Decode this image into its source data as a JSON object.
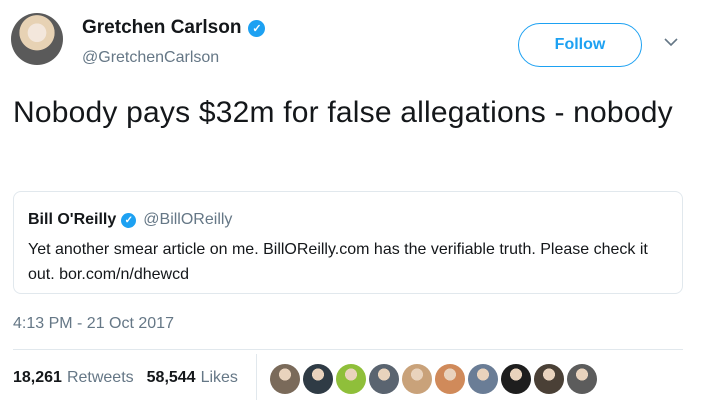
{
  "author": {
    "name": "Gretchen Carlson",
    "handle": "@GretchenCarlson",
    "verified_icon": "verified-badge-icon",
    "avatar_icon": "avatar"
  },
  "header": {
    "follow_label": "Follow",
    "more_icon": "chevron-down-icon"
  },
  "tweet": {
    "text": "Nobody pays $32m for false allegations - nobody",
    "timestamp": "4:13 PM - 21 Oct 2017"
  },
  "quoted_tweet": {
    "name": "Bill O'Reilly",
    "handle": "@BillOReilly",
    "text": "Yet another smear article on me. BillOReilly.com has the verifiable truth. Please check it out. bor.com/n/dhewcd"
  },
  "stats": {
    "retweets_count": "18,261",
    "retweets_label": "Retweets",
    "likes_count": "58,544",
    "likes_label": "Likes"
  },
  "likers": [
    {
      "icon": "liker-avatar",
      "color": "#7a6a5a"
    },
    {
      "icon": "liker-avatar",
      "color": "#2f3b45"
    },
    {
      "icon": "liker-avatar",
      "color": "#8fbf3a"
    },
    {
      "icon": "liker-avatar",
      "color": "#5a6470"
    },
    {
      "icon": "liker-avatar",
      "color": "#c9a27a"
    },
    {
      "icon": "liker-avatar",
      "color": "#d08a5a"
    },
    {
      "icon": "liker-avatar",
      "color": "#6a7d96"
    },
    {
      "icon": "liker-avatar",
      "color": "#1e1e1e"
    },
    {
      "icon": "liker-avatar",
      "color": "#4a4036"
    },
    {
      "icon": "liker-avatar",
      "color": "#5c5c5c"
    }
  ],
  "colors": {
    "accent": "#1da1f2",
    "text": "#14171a",
    "muted": "#657786",
    "border": "#e1e8ed"
  }
}
